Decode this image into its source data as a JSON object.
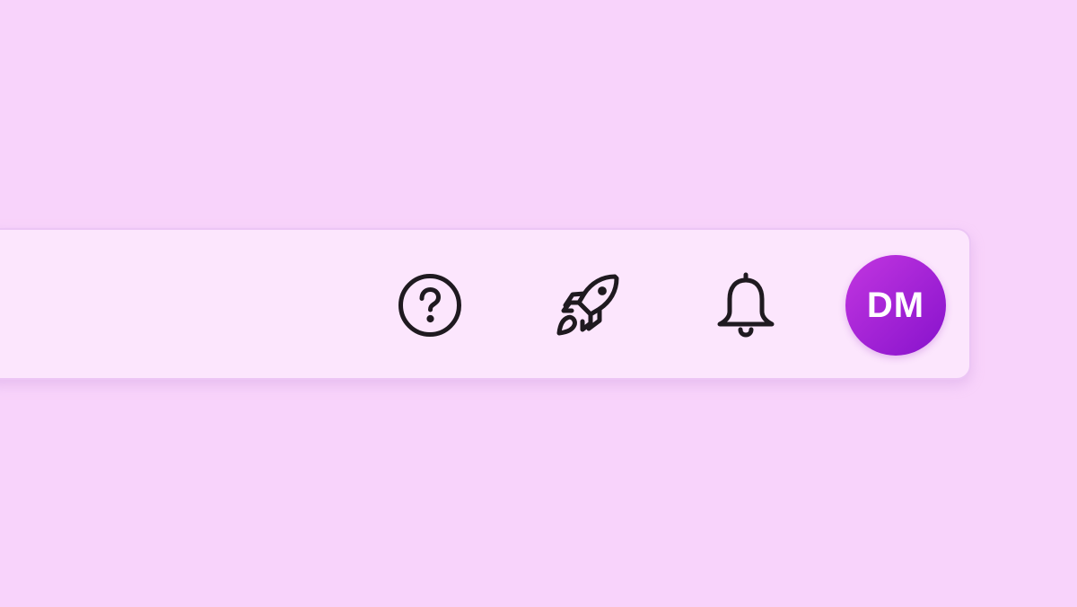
{
  "theme": {
    "page_background": "#f8d3fb",
    "bar_background": "#fce6fd",
    "bar_border": "#ecc6f5",
    "icon_color": "#1f1a20"
  },
  "toolbar": {
    "icons": [
      {
        "name": "help-icon"
      },
      {
        "name": "rocket-icon"
      },
      {
        "name": "bell-icon"
      }
    ],
    "avatar": {
      "initials": "DM",
      "color_start": "#c236e0",
      "color_end": "#8712cc"
    }
  }
}
